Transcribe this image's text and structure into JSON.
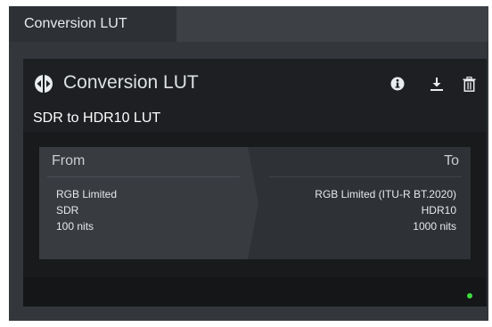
{
  "tab": {
    "label": "Conversion LUT"
  },
  "card": {
    "title": "Conversion LUT",
    "subtitle": "SDR to HDR10 LUT",
    "icons": [
      "lut-logo-icon",
      "info-icon",
      "download-icon",
      "trash-icon"
    ]
  },
  "mapping": {
    "from": {
      "label": "From",
      "values": [
        "RGB Limited",
        "SDR",
        "100 nits"
      ]
    },
    "to": {
      "label": "To",
      "values": [
        "RGB Limited (ITU-R BT.2020)",
        "HDR10",
        "1000 nits"
      ]
    }
  },
  "status": {
    "color": "#3ddc3d"
  },
  "colors": {
    "panel": "#33373c",
    "card": "#181a1c",
    "from_section": "#383c41",
    "to_section": "#2e3236"
  }
}
